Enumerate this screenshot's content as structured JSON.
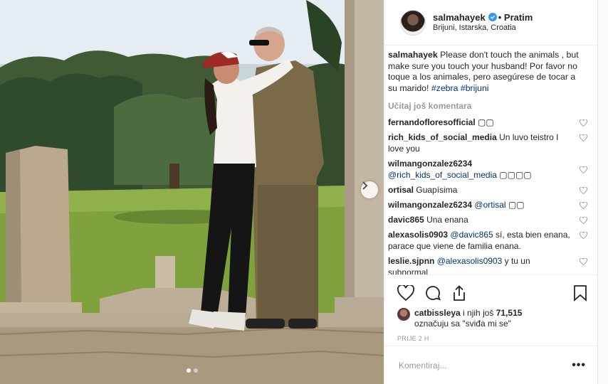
{
  "post": {
    "username": "salmahayek",
    "follow_label": "• Pratim",
    "location": "Brijuni, Istarska, Croatia",
    "caption": {
      "username": "salmahayek",
      "text": "Please don't touch the animals , but make sure you touch your husband! Por favor no toque a los animales, pero asegúrese de tocar a su marido!",
      "tags": [
        "#zebra",
        "#brijuni"
      ]
    },
    "load_more_label": "Učitaj još komentara",
    "comments": [
      {
        "user": "fernandofloresofficial",
        "text": "▢▢"
      },
      {
        "user": "rich_kids_of_social_media",
        "text": "Un luvo teistro I love you"
      },
      {
        "user": "wilmangonzalez6234",
        "mention": "@rich_kids_of_social_media",
        "text": "▢▢▢▢"
      },
      {
        "user": "ortisal",
        "text": "Guapísima"
      },
      {
        "user": "wilmangonzalez6234",
        "mention": "@ortisal",
        "text": "▢▢"
      },
      {
        "user": "davic865",
        "text": "Una enana"
      },
      {
        "user": "alexasolis0903",
        "mention": "@davic865",
        "text": "sí, esta bien enana, parace que viene de familia enana."
      },
      {
        "user": "leslie.sjpnn",
        "mention": "@alexasolis0903",
        "text": "y tu un subnormal"
      }
    ],
    "likes": {
      "user": "catbissleya",
      "text_mid": " i njih još ",
      "count": "71,515",
      "text_end": "označuju sa \"sviđa mi se\""
    },
    "timestamp": "PRIJE 2 H",
    "comment_placeholder": "Komentiraj...",
    "more_label": "•••"
  },
  "carousel": {
    "total": 2,
    "active": 1
  },
  "icons": {
    "verified": "verified-badge-icon",
    "heart": "heart-icon",
    "comment": "comment-icon",
    "share": "share-icon",
    "save": "bookmark-icon",
    "next": "chevron-right-icon"
  },
  "colors": {
    "verified": "#3897f0",
    "link": "#003569",
    "muted": "#999999"
  }
}
